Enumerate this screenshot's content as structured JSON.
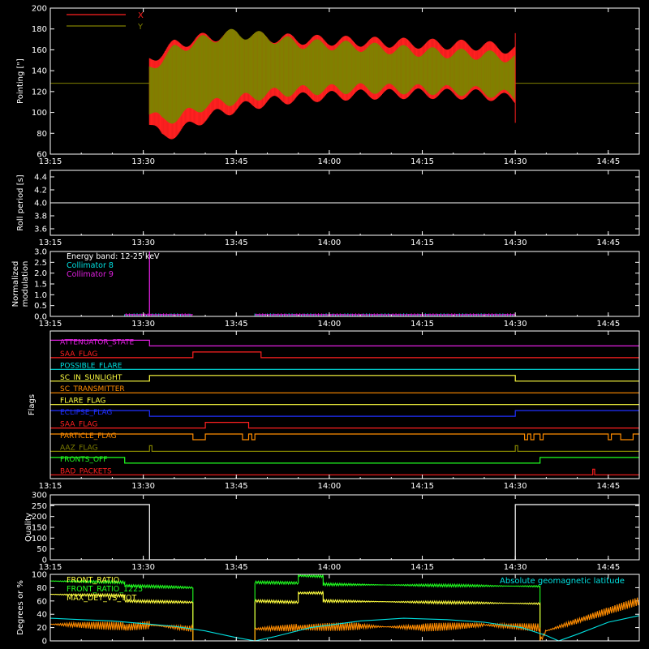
{
  "colors": {
    "background": "#000000",
    "axes": "#ffffff",
    "x": "#ff2020",
    "y": "#808000",
    "cyan": "#00e0e0",
    "magenta": "#e020e0",
    "green": "#20ff20",
    "yellow": "#ffff40",
    "orange": "#ff8c00"
  },
  "time_axis": {
    "start_min": 0,
    "end_min": 95,
    "tick_minutes": [
      0,
      15,
      30,
      45,
      60,
      75,
      90
    ],
    "tick_labels": [
      "13:15",
      "13:30",
      "13:45",
      "14:00",
      "14:15",
      "14:30",
      "14:45"
    ]
  },
  "chart_data": [
    {
      "id": "pointing",
      "type": "line",
      "ylabel": "Pointing [\"]",
      "ylim": [
        60,
        200
      ],
      "yticks": [
        60,
        80,
        100,
        120,
        140,
        160,
        180,
        200
      ],
      "legend": [
        "X",
        "Y"
      ],
      "flat_value": 128,
      "active_start": 16,
      "active_end": 75,
      "series": [
        {
          "name": "X",
          "upper": [
            [
              16,
              150
            ],
            [
              20,
              165
            ],
            [
              25,
              172
            ],
            [
              30,
              175
            ],
            [
              35,
              172
            ],
            [
              40,
              170
            ],
            [
              50,
              168
            ],
            [
              60,
              166
            ],
            [
              70,
              164
            ],
            [
              75,
              160
            ]
          ],
          "lower": [
            [
              16,
              90
            ],
            [
              18,
              76
            ],
            [
              21,
              82
            ],
            [
              25,
              95
            ],
            [
              30,
              104
            ],
            [
              35,
              110
            ],
            [
              40,
              114
            ],
            [
              50,
              117
            ],
            [
              60,
              118
            ],
            [
              70,
              117
            ],
            [
              75,
              112
            ]
          ]
        },
        {
          "name": "Y",
          "upper": [
            [
              16,
              142
            ],
            [
              20,
              160
            ],
            [
              25,
              170
            ],
            [
              30,
              176
            ],
            [
              35,
              172
            ],
            [
              40,
              166
            ],
            [
              50,
              163
            ],
            [
              60,
              158
            ],
            [
              70,
              155
            ],
            [
              75,
              152
            ]
          ],
          "lower": [
            [
              16,
              100
            ],
            [
              18,
              92
            ],
            [
              21,
              96
            ],
            [
              25,
              107
            ],
            [
              30,
              112
            ],
            [
              35,
              118
            ],
            [
              40,
              121
            ],
            [
              50,
              123
            ],
            [
              60,
              122
            ],
            [
              70,
              120
            ],
            [
              75,
              115
            ]
          ]
        }
      ]
    },
    {
      "id": "roll",
      "type": "line",
      "ylabel": "Roll period [s]",
      "ylim": [
        3.5,
        4.5
      ],
      "yticks": [
        3.6,
        3.8,
        4.0,
        4.2,
        4.4
      ],
      "ytick_labels": [
        "3.6",
        "3.8",
        "4.0",
        "4.2",
        "4.4"
      ],
      "value": 4.0
    },
    {
      "id": "modulation",
      "type": "line",
      "ylabel_lines": [
        "Normalized",
        "modulation"
      ],
      "ylim": [
        0,
        3.0
      ],
      "yticks": [
        0.0,
        0.5,
        1.0,
        1.5,
        2.0,
        2.5,
        3.0
      ],
      "ytick_labels": [
        "0.0",
        "0.5",
        "1.0",
        "1.5",
        "2.0",
        "2.5",
        "3.0"
      ],
      "legend": [
        "Energy band: 12-25 keV",
        "Collimator 8",
        "Collimator 9"
      ],
      "segments": [
        [
          12,
          23
        ],
        [
          33,
          75
        ]
      ],
      "spike": {
        "t": 16,
        "value": 3.0
      },
      "level": 0.08
    },
    {
      "id": "flags",
      "type": "line",
      "ylabel": "Flags",
      "rows": [
        {
          "name": "ATTENUATOR_STATE",
          "color": "#e020e0",
          "states": [
            [
              0,
              1
            ],
            [
              16,
              0
            ]
          ]
        },
        {
          "name": "SAA_FLAG",
          "color": "#ff2020",
          "states": [
            [
              0,
              0
            ],
            [
              23,
              1
            ],
            [
              34,
              0
            ]
          ]
        },
        {
          "name": "POSSIBLE_FLARE",
          "color": "#00e0e0",
          "states": [
            [
              0,
              0
            ]
          ]
        },
        {
          "name": "SC_IN_SUNLIGHT",
          "color": "#ffff40",
          "states": [
            [
              0,
              0
            ],
            [
              16,
              1
            ],
            [
              75,
              0
            ]
          ]
        },
        {
          "name": "SC_TRANSMITTER",
          "color": "#ff8c00",
          "states": [
            [
              0,
              0
            ]
          ]
        },
        {
          "name": "FLARE_FLAG",
          "color": "#ffff40",
          "states": [
            [
              0,
              0
            ]
          ]
        },
        {
          "name": "ECLIPSE_FLAG",
          "color": "#2030ff",
          "states": [
            [
              0,
              1
            ],
            [
              16,
              0
            ],
            [
              75,
              1
            ]
          ]
        },
        {
          "name": "SAA_FLAG",
          "color": "#ff2020",
          "states": [
            [
              0,
              0
            ],
            [
              25,
              1
            ],
            [
              32,
              0
            ]
          ]
        },
        {
          "name": "PARTICLE_FLAG",
          "color": "#ff8c00",
          "states": [
            [
              0,
              1
            ],
            [
              23,
              0
            ],
            [
              25,
              1
            ],
            [
              31,
              0
            ],
            [
              32,
              1
            ],
            [
              32.5,
              0
            ],
            [
              33,
              1
            ],
            [
              76.5,
              0
            ],
            [
              77,
              1
            ],
            [
              77.5,
              0
            ],
            [
              78,
              1
            ],
            [
              79,
              0
            ],
            [
              79.5,
              1
            ],
            [
              90,
              0
            ],
            [
              90.5,
              1
            ],
            [
              92,
              0
            ],
            [
              94,
              1
            ]
          ]
        },
        {
          "name": "AAZ_FLAG",
          "color": "#808000",
          "states": [
            [
              0,
              0
            ],
            [
              16,
              1
            ],
            [
              16.4,
              0
            ],
            [
              75,
              1
            ],
            [
              75.4,
              0
            ]
          ]
        },
        {
          "name": "FRONTS_OFF",
          "color": "#20ff20",
          "states": [
            [
              0,
              1
            ],
            [
              12,
              0
            ],
            [
              79,
              1
            ]
          ]
        },
        {
          "name": "BAD_PACKETS",
          "color": "#ff2020",
          "states": [
            [
              0,
              0
            ],
            [
              87.5,
              1
            ],
            [
              87.8,
              0
            ]
          ]
        }
      ]
    },
    {
      "id": "quality",
      "type": "line",
      "ylabel": "Quality",
      "ylim": [
        0,
        300
      ],
      "yticks": [
        0,
        50,
        100,
        150,
        200,
        250,
        300
      ],
      "ytick_labels": [
        "0",
        "50",
        "100",
        "150",
        "200",
        "250",
        "300"
      ],
      "points": [
        [
          0,
          255
        ],
        [
          16,
          255
        ],
        [
          16,
          0
        ],
        [
          75,
          0
        ],
        [
          75,
          255
        ],
        [
          95,
          255
        ]
      ]
    },
    {
      "id": "ratios",
      "type": "line",
      "ylabel": "Degrees or %",
      "ylim": [
        0,
        100
      ],
      "yticks": [
        0,
        20,
        40,
        60,
        80,
        100
      ],
      "ytick_labels": [
        "0",
        "20",
        "40",
        "60",
        "80",
        "100"
      ],
      "legend": [
        "FRONT_RATIO",
        "FRONT_RATIO_1225",
        "MAX_DET_VS_TOT"
      ],
      "legend_right": "Absolute geomagnetic latitude",
      "series": [
        {
          "name": "FRONT_RATIO_1225",
          "color": "#20ff20",
          "points": [
            [
              0,
              90
            ],
            [
              12,
              88
            ],
            [
              12,
              83
            ],
            [
              23,
              80
            ],
            [
              23,
              0
            ],
            [
              33,
              0
            ],
            [
              33,
              88
            ],
            [
              40,
              87
            ],
            [
              40,
              98
            ],
            [
              44,
              97
            ],
            [
              44,
              85
            ],
            [
              79,
              82
            ],
            [
              79,
              0
            ],
            [
              95,
              0
            ]
          ]
        },
        {
          "name": "MAX_DET_VS_TOT",
          "color": "#ffff40",
          "points": [
            [
              0,
              70
            ],
            [
              12,
              68
            ],
            [
              12,
              60
            ],
            [
              23,
              58
            ],
            [
              23,
              0
            ],
            [
              33,
              0
            ],
            [
              33,
              60
            ],
            [
              40,
              58
            ],
            [
              40,
              72
            ],
            [
              44,
              72
            ],
            [
              44,
              60
            ],
            [
              79,
              56
            ],
            [
              79,
              0
            ],
            [
              95,
              0
            ]
          ]
        },
        {
          "name": "FRONT_RATIO",
          "color": "#ff8c00",
          "points": [
            [
              0,
              25
            ],
            [
              12,
              22
            ],
            [
              12,
              20
            ],
            [
              16,
              24
            ],
            [
              23,
              18
            ],
            [
              23,
              0
            ],
            [
              33,
              0
            ],
            [
              33,
              18
            ],
            [
              40,
              20
            ],
            [
              50,
              22
            ],
            [
              60,
              20
            ],
            [
              70,
              24
            ],
            [
              79,
              20
            ],
            [
              79,
              0
            ],
            [
              80,
              15
            ],
            [
              85,
              30
            ],
            [
              90,
              45
            ],
            [
              95,
              60
            ]
          ]
        },
        {
          "name": "Absolute geomagnetic latitude",
          "color": "#00e0e0",
          "points": [
            [
              0,
              34
            ],
            [
              5,
              32
            ],
            [
              10,
              30
            ],
            [
              15,
              26
            ],
            [
              20,
              22
            ],
            [
              25,
              15
            ],
            [
              30,
              5
            ],
            [
              33,
              0
            ],
            [
              36,
              6
            ],
            [
              42,
              20
            ],
            [
              50,
              30
            ],
            [
              57,
              34
            ],
            [
              64,
              32
            ],
            [
              70,
              28
            ],
            [
              76,
              20
            ],
            [
              80,
              8
            ],
            [
              82,
              0
            ],
            [
              85,
              10
            ],
            [
              90,
              28
            ],
            [
              95,
              38
            ]
          ]
        }
      ]
    }
  ]
}
